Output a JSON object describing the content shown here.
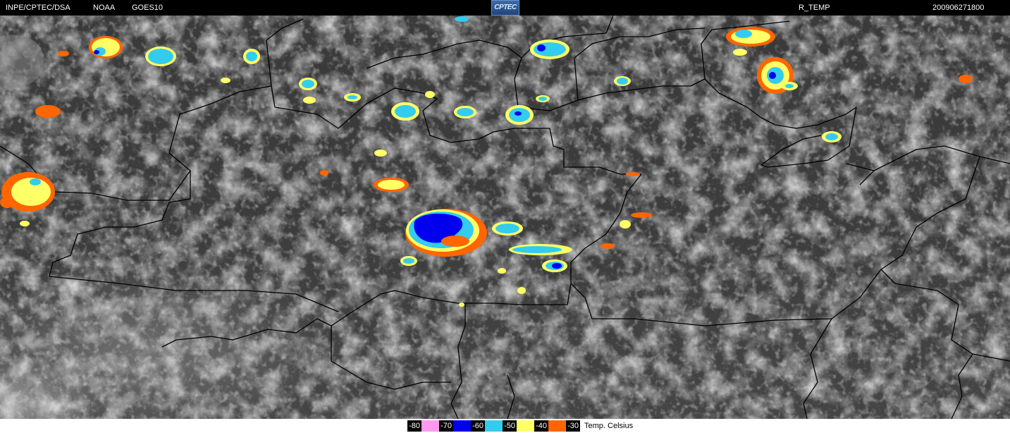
{
  "header": {
    "source": "INPE/CPTEC/DSA",
    "agency": "NOAA",
    "satellite": "GOES10",
    "logo_text": "CPTEC",
    "product": "R_TEMP",
    "datetime": "200906271800"
  },
  "legend": {
    "unit": "Temp. Celsius",
    "entries": [
      {
        "label": "-80",
        "color": "#ff99ee"
      },
      {
        "label": "-70",
        "color": "#0000ee"
      },
      {
        "label": "-60",
        "color": "#33ccee"
      },
      {
        "label": "-50",
        "color": "#ffff66"
      },
      {
        "label": "-40",
        "color": "#ff6600"
      },
      {
        "label": "-30",
        "color": ""
      }
    ]
  },
  "map": {
    "type": "infrared satellite imagery",
    "enhanced_colors": [
      "#ff6600",
      "#ffff66",
      "#33ccee",
      "#0000ee"
    ]
  }
}
